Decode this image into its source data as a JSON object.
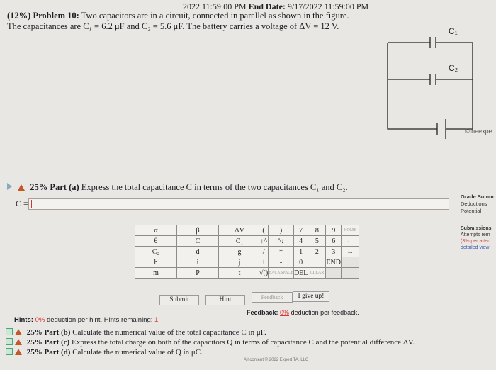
{
  "header": {
    "date_fragment": "2022 11:59:00 PM",
    "end_label": "End Date:",
    "end_value": "9/17/2022 11:59:00 PM"
  },
  "problem": {
    "percent": "(12%)",
    "title": "Problem 10:",
    "statement_line1": "Two capacitors are in a circuit, connected in parallel as shown in the figure.",
    "statement_line2": "The capacitances are C₁ = 6.2 μF and C₂ = 5.6 μF. The battery carries a voltage of ΔV = 12 V."
  },
  "circuit": {
    "c1_label": "C₁",
    "c2_label": "C₂",
    "caption": "©theexpe"
  },
  "part_a": {
    "percent": "25% Part (a)",
    "text": "Express the total capacitance C in terms of the two capacitances C₁ and C₂.",
    "input_label": "C =",
    "input_value": ""
  },
  "grade_summary": {
    "title": "Grade Summ",
    "deductions": "Deductions",
    "potential": "Potential"
  },
  "submissions": {
    "title": "Submissions",
    "attempts": "Attempts rem",
    "per_attempt": "(3% per atten",
    "detailed_view": "detailed view"
  },
  "symbol_keys": [
    [
      "α",
      "β",
      "ΔV"
    ],
    [
      "θ",
      "C",
      "C₁"
    ],
    [
      "C₂",
      "d",
      "g"
    ],
    [
      "h",
      "i",
      "j"
    ],
    [
      "m",
      "P",
      "t"
    ]
  ],
  "keypad": {
    "rows": [
      [
        "(",
        ")",
        "7",
        "8",
        "9",
        "HOME"
      ],
      [
        "↑^",
        "^↓",
        "4",
        "5",
        "6",
        "←"
      ],
      [
        "/",
        "*",
        "1",
        "2",
        "3",
        "→"
      ],
      [
        "+",
        "-",
        "0",
        ".",
        "END",
        ""
      ],
      [
        "√()",
        "BACKSPACE",
        "DEL",
        "CLEAR",
        "",
        ""
      ]
    ]
  },
  "buttons": {
    "submit": "Submit",
    "hint": "Hint",
    "feedback": "Feedback",
    "give_up": "I give up!"
  },
  "hints": {
    "label": "Hints:",
    "pct": "0%",
    "text": "deduction per hint. Hints remaining:",
    "remaining": "1"
  },
  "feedback": {
    "label": "Feedback:",
    "pct": "0%",
    "text": "deduction per feedback."
  },
  "other_parts": [
    {
      "percent": "25% Part (b)",
      "text": "Calculate the numerical value of the total capacitance C in μF."
    },
    {
      "percent": "25% Part (c)",
      "text": "Express the total charge on both of the capacitors Q in terms of capacitance C and the potential difference ΔV."
    },
    {
      "percent": "25% Part (d)",
      "text": "Calculate the numerical value of Q in μC."
    }
  ],
  "footer": {
    "copyright": "All content © 2022 Expert TA, LLC"
  },
  "colors": {
    "warning": "#c45828",
    "link": "#3a5aa8",
    "deduction": "#d33"
  }
}
